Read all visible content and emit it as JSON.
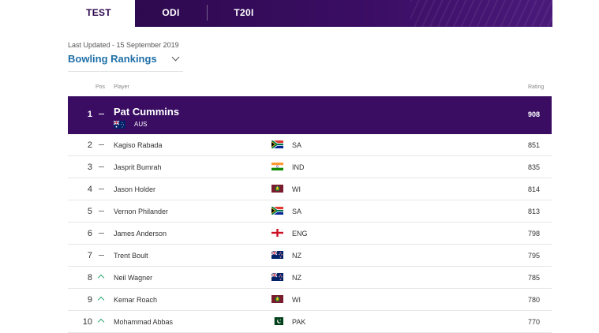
{
  "tabs": [
    {
      "label": "TEST",
      "active": true
    },
    {
      "label": "ODI",
      "active": false
    },
    {
      "label": "T20I",
      "active": false
    }
  ],
  "last_updated": "Last Updated - 15 September 2019",
  "ranking_selector": {
    "label": "Bowling Rankings",
    "icon": "chevron-down-icon"
  },
  "columns": {
    "pos": "Pos",
    "player": "Player",
    "rating": "Rating"
  },
  "rows": [
    {
      "pos": "1",
      "movement": "none",
      "player": "Pat Cummins",
      "team": "AUS",
      "flag": "flag-aus",
      "rating": "908"
    },
    {
      "pos": "2",
      "movement": "none",
      "player": "Kagiso Rabada",
      "team": "SA",
      "flag": "flag-sa",
      "rating": "851"
    },
    {
      "pos": "3",
      "movement": "none",
      "player": "Jasprit Bumrah",
      "team": "IND",
      "flag": "flag-ind",
      "rating": "835"
    },
    {
      "pos": "4",
      "movement": "none",
      "player": "Jason Holder",
      "team": "WI",
      "flag": "flag-wi",
      "rating": "814"
    },
    {
      "pos": "5",
      "movement": "none",
      "player": "Vernon Philander",
      "team": "SA",
      "flag": "flag-sa",
      "rating": "813"
    },
    {
      "pos": "6",
      "movement": "none",
      "player": "James Anderson",
      "team": "ENG",
      "flag": "flag-eng",
      "rating": "798"
    },
    {
      "pos": "7",
      "movement": "none",
      "player": "Trent Boult",
      "team": "NZ",
      "flag": "flag-nz",
      "rating": "795"
    },
    {
      "pos": "8",
      "movement": "up",
      "player": "Neil Wagner",
      "team": "NZ",
      "flag": "flag-nz",
      "rating": "785"
    },
    {
      "pos": "9",
      "movement": "up",
      "player": "Kemar Roach",
      "team": "WI",
      "flag": "flag-wi",
      "rating": "780"
    },
    {
      "pos": "10",
      "movement": "up",
      "player": "Mohammad Abbas",
      "team": "PAK",
      "flag": "flag-pak",
      "rating": "770"
    }
  ],
  "colors": {
    "header_purple": "#3a0d63",
    "link_blue": "#2070a8",
    "movement_up": "#2aa872"
  }
}
